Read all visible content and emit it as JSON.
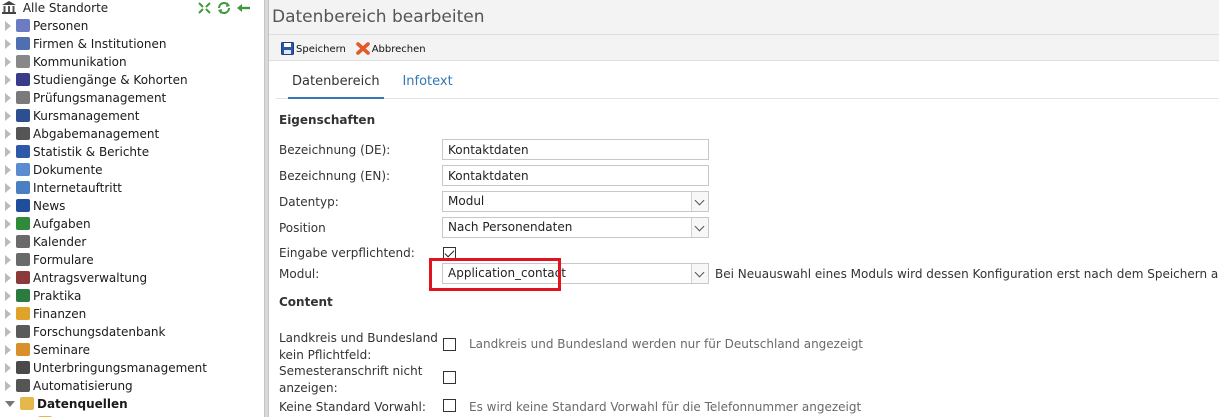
{
  "sidebar": {
    "root_label": "Alle Standorte",
    "items": [
      {
        "label": "Personen",
        "icon": "people-icon",
        "color": "#6b7cc4"
      },
      {
        "label": "Firmen & Institutionen",
        "icon": "factory-icon",
        "color": "#4f6fb0"
      },
      {
        "label": "Kommunikation",
        "icon": "envelope-icon",
        "color": "#888888"
      },
      {
        "label": "Studiengänge & Kohorten",
        "icon": "quill-icon",
        "color": "#3b3b8c"
      },
      {
        "label": "Prüfungsmanagement",
        "icon": "clipboard-icon",
        "color": "#7a7a7a"
      },
      {
        "label": "Kursmanagement",
        "icon": "book-icon",
        "color": "#2e4f8f"
      },
      {
        "label": "Abgabemanagement",
        "icon": "id-card-icon",
        "color": "#555555"
      },
      {
        "label": "Statistik & Berichte",
        "icon": "bar-chart-icon",
        "color": "#2d59a8"
      },
      {
        "label": "Dokumente",
        "icon": "folder-icon",
        "color": "#5b8bd1"
      },
      {
        "label": "Internetauftritt",
        "icon": "globe-icon",
        "color": "#4a7fc1"
      },
      {
        "label": "News",
        "icon": "info-icon",
        "color": "#1f4f9c"
      },
      {
        "label": "Aufgaben",
        "icon": "refresh-icon",
        "color": "#2f8a3a"
      },
      {
        "label": "Kalender",
        "icon": "calendar-icon",
        "color": "#6a6a6a"
      },
      {
        "label": "Formulare",
        "icon": "form-icon",
        "color": "#6a6a6a"
      },
      {
        "label": "Antragsverwaltung",
        "icon": "ticket-icon",
        "color": "#8a3a3a"
      },
      {
        "label": "Praktika",
        "icon": "network-icon",
        "color": "#2b7a3f"
      },
      {
        "label": "Finanzen",
        "icon": "coins-icon",
        "color": "#e0a32a"
      },
      {
        "label": "Forschungsdatenbank",
        "icon": "line-chart-icon",
        "color": "#5a5a5a"
      },
      {
        "label": "Seminare",
        "icon": "briefcase-icon",
        "color": "#d9902a"
      },
      {
        "label": "Unterbringungsmanagement",
        "icon": "building-icon",
        "color": "#4a4a4a"
      },
      {
        "label": "Automatisierung",
        "icon": "gear-icon",
        "color": "#555555"
      },
      {
        "label": "Datenquellen",
        "icon": "database-folder-icon",
        "color": "#e6b84c",
        "active": true
      }
    ]
  },
  "main": {
    "title": "Datenbereich bearbeiten",
    "toolbar": {
      "save_label": "Speichern",
      "cancel_label": "Abbrechen"
    },
    "tabs": [
      {
        "label": "Datenbereich",
        "active": true
      },
      {
        "label": "Infotext",
        "active": false
      }
    ],
    "section_properties": "Eigenschaften",
    "fields": {
      "name_de_label": "Bezeichnung (DE):",
      "name_de_value": "Kontaktdaten",
      "name_en_label": "Bezeichnung (EN):",
      "name_en_value": "Kontaktdaten",
      "datatype_label": "Datentyp:",
      "datatype_value": "Modul",
      "position_label": "Position",
      "position_value": "Nach Personendaten",
      "required_label": "Eingabe verpflichtend:",
      "required_checked": true,
      "module_label": "Modul:",
      "module_value": "Application_contact",
      "module_hint": "Bei Neuauswahl eines Moduls wird dessen Konfiguration erst nach dem Speichern angezeigt."
    },
    "section_content": "Content",
    "content_fields": {
      "district_label_1": "Landkreis und Bundesland",
      "district_label_2": "kein Pflichtfeld:",
      "district_hint": "Landkreis und Bundesland werden nur für Deutschland angezeigt",
      "semester_label_1": "Semesteranschrift nicht",
      "semester_label_2": "anzeigen:",
      "dialcode_label": "Keine Standard Vorwahl:",
      "dialcode_hint": "Es wird keine Standard Vorwahl für die Telefonnummer angezeigt"
    },
    "colors": {
      "accent": "#3477b5",
      "highlight": "#e0141e"
    }
  }
}
